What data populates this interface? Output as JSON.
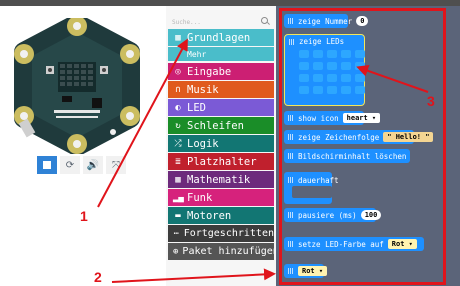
{
  "simulator": {
    "buttons": [
      {
        "name": "stop-button",
        "icon": "stop-icon",
        "label": ""
      },
      {
        "name": "restart-button",
        "icon": "restart-icon",
        "label": "⟳"
      },
      {
        "name": "mute-button",
        "icon": "sound-icon",
        "label": "🔊"
      },
      {
        "name": "fullscreen-button",
        "icon": "fullscreen-icon",
        "label": "⤧"
      }
    ]
  },
  "toolbox": {
    "search_placeholder": "Suche...",
    "categories": [
      {
        "label": "Grundlagen",
        "icon": "grid-icon",
        "color": "#1e90ff"
      },
      {
        "label": "Mehr",
        "icon": "",
        "color": "#1e90ff"
      },
      {
        "label": "Eingabe",
        "icon": "target-icon",
        "color": "#d400d4"
      },
      {
        "label": "Musik",
        "icon": "headphones-icon",
        "color": "#e63022"
      },
      {
        "label": "LED",
        "icon": "toggle-icon",
        "color": "#5c2d91"
      },
      {
        "label": "Schleifen",
        "icon": "loop-icon",
        "color": "#00aa00"
      },
      {
        "label": "Logik",
        "icon": "shuffle-icon",
        "color": "#00a4a6"
      },
      {
        "label": "Platzhalter",
        "icon": "list-icon",
        "color": "#dc143c"
      },
      {
        "label": "Mathematik",
        "icon": "calculator-icon",
        "color": "#9400d3"
      },
      {
        "label": "Funk",
        "icon": "signal-icon",
        "color": "#e3008c"
      },
      {
        "label": "Motoren",
        "icon": "car-icon",
        "color": "#008272"
      },
      {
        "label": "Fortgeschritten",
        "icon": "more-icon",
        "color": "#3c3c3c"
      },
      {
        "label": "Paket hinzufügen",
        "icon": "plus-icon",
        "color": "#3c3c3c"
      }
    ]
  },
  "workspace": {
    "blocks": {
      "show_number": {
        "label": "zeige Nummer",
        "value": "0"
      },
      "show_leds": {
        "label": "zeige LEDs"
      },
      "show_icon": {
        "label": "show icon",
        "value": "heart ▾"
      },
      "show_string": {
        "label": "zeige Zeichenfolge",
        "value": "\" Hello! \""
      },
      "clear_screen": {
        "label": "Bildschirminhalt löschen"
      },
      "forever": {
        "label": "dauerhaft"
      },
      "pause": {
        "label": "pausiere (ms)",
        "value": "100"
      },
      "set_led_color": {
        "label": "setze LED-Farbe auf",
        "value": "Rot ▾"
      },
      "color_red": {
        "label": "",
        "value": "Rot ▾"
      }
    }
  },
  "annotations": {
    "one": "1",
    "two": "2",
    "three": "3",
    "color": "#e0141b"
  }
}
